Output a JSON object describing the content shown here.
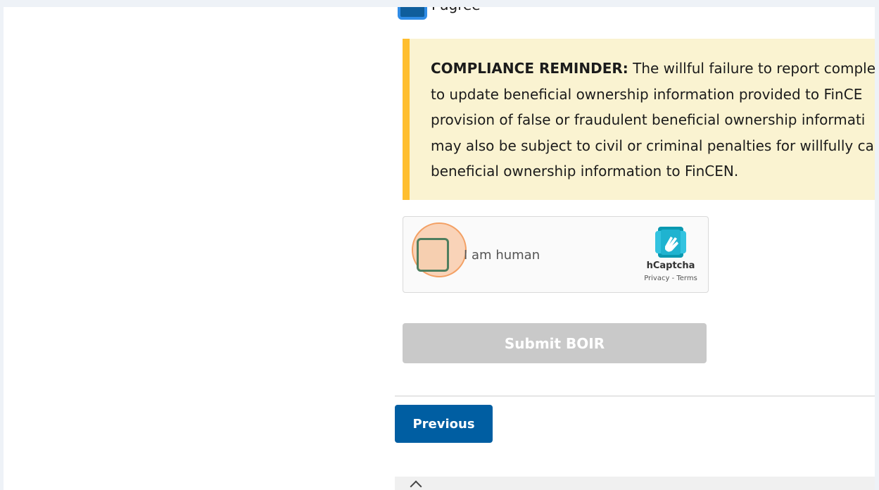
{
  "agree": {
    "label": "I agree",
    "checked": true
  },
  "compliance": {
    "heading": "COMPLIANCE REMINDER:",
    "lines": [
      " The willful failure to report complet",
      "to update beneficial ownership information provided to FinCE",
      "provision of false or fraudulent beneficial ownership informati",
      "may also be subject to civil or criminal penalties for willfully ca",
      "beneficial ownership information to FinCEN."
    ]
  },
  "captcha": {
    "label": "I am human",
    "brand": "hCaptcha",
    "links": "Privacy - Terms"
  },
  "actions": {
    "submit_label": "Submit BOIR",
    "previous_label": "Previous"
  },
  "colors": {
    "primary": "#005ea2",
    "warning_border": "#ffbe2e",
    "warning_bg": "#faf3d1",
    "disabled": "#c9c9c9"
  }
}
